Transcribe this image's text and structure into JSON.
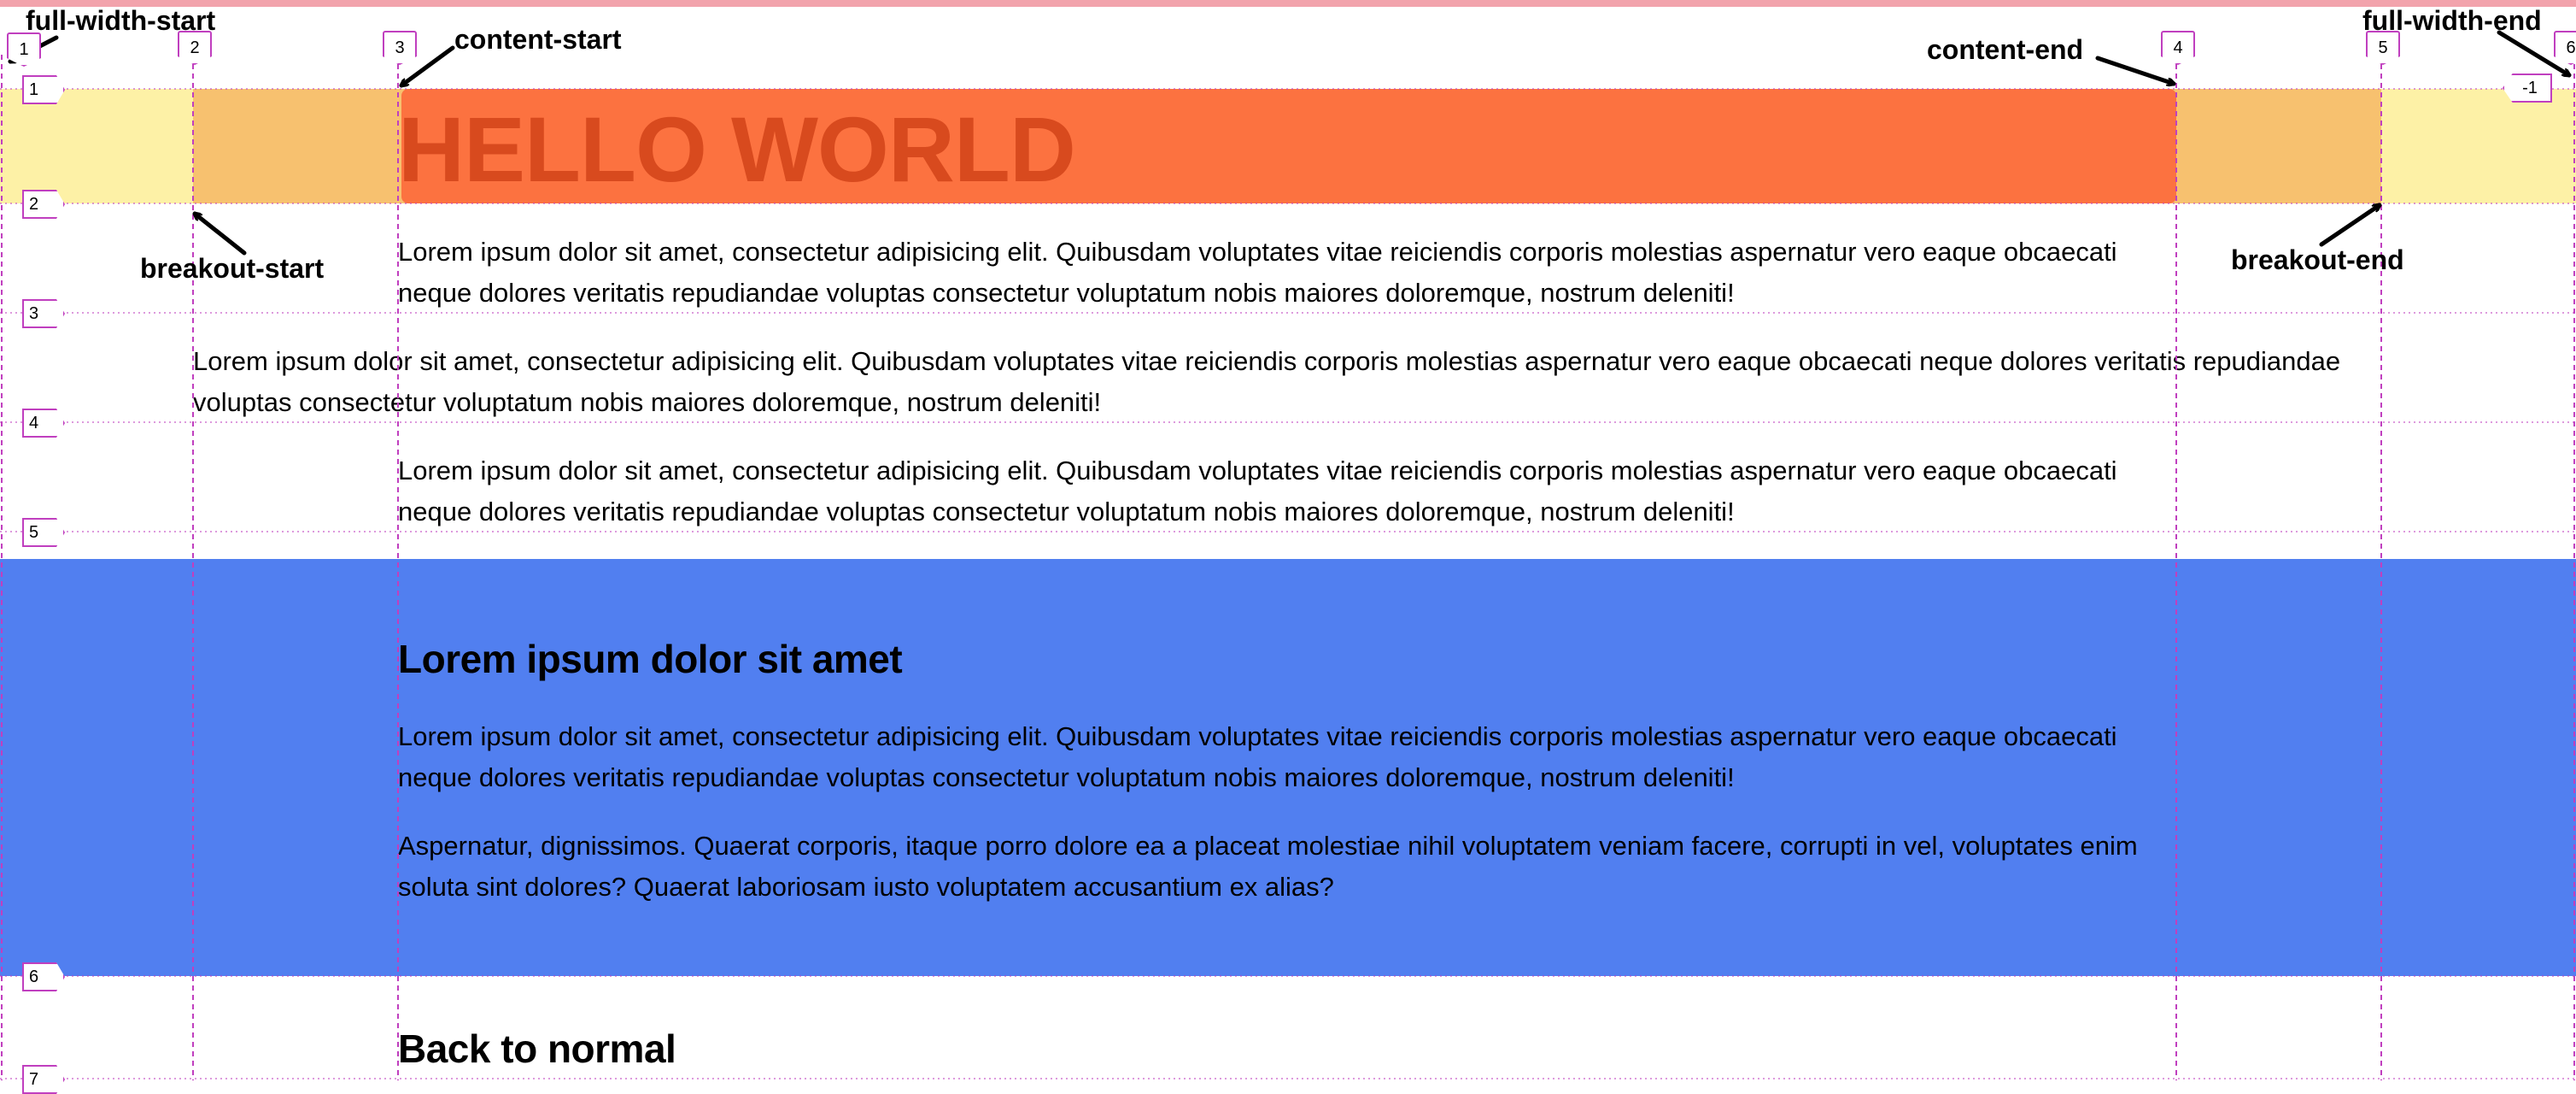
{
  "colors": {
    "top_bar": "#f2a3ac",
    "full_width_band": "#fdf1a6",
    "breakout_band": "#f7c16f",
    "content_band": "#fc7240",
    "hero_title": "#d84a1e",
    "blue_section": "#517ff0",
    "grid_line": "#c03fbf"
  },
  "annotations": {
    "full_width_start": "full-width-start",
    "full_width_end": "full-width-end",
    "content_start": "content-start",
    "content_end": "content-end",
    "breakout_start": "breakout-start",
    "breakout_end": "breakout-end"
  },
  "column_lines": [
    "1",
    "2",
    "3",
    "4",
    "5",
    "6",
    "-1"
  ],
  "row_lines": [
    "1",
    "2",
    "3",
    "4",
    "5",
    "6",
    "7"
  ],
  "hero": {
    "title": "HELLO WORLD"
  },
  "paragraphs": {
    "p1": "Lorem ipsum dolor sit amet, consectetur adipisicing elit. Quibusdam voluptates vitae reiciendis corporis molestias aspernatur vero eaque obcaecati neque dolores veritatis repudiandae voluptas consectetur voluptatum nobis maiores doloremque, nostrum deleniti!",
    "p2": "Lorem ipsum dolor sit amet, consectetur adipisicing elit. Quibusdam voluptates vitae reiciendis corporis molestias aspernatur vero eaque obcaecati neque dolores veritatis repudiandae voluptas consectetur voluptatum nobis maiores doloremque, nostrum deleniti!",
    "p3": "Lorem ipsum dolor sit amet, consectetur adipisicing elit. Quibusdam voluptates vitae reiciendis corporis molestias aspernatur vero eaque obcaecati neque dolores veritatis repudiandae voluptas consectetur voluptatum nobis maiores doloremque, nostrum deleniti!"
  },
  "section": {
    "heading": "Lorem ipsum dolor sit amet",
    "p1": "Lorem ipsum dolor sit amet, consectetur adipisicing elit. Quibusdam voluptates vitae reiciendis corporis molestias aspernatur vero eaque obcaecati neque dolores veritatis repudiandae voluptas consectetur voluptatum nobis maiores doloremque, nostrum deleniti!",
    "p2": "Aspernatur, dignissimos. Quaerat corporis, itaque porro dolore ea a placeat molestiae nihil voluptatem veniam facere, corrupti in vel, voluptates enim soluta sint dolores? Quaerat laboriosam iusto voluptatem accusantium ex alias?"
  },
  "footer": {
    "heading": "Back to normal"
  }
}
